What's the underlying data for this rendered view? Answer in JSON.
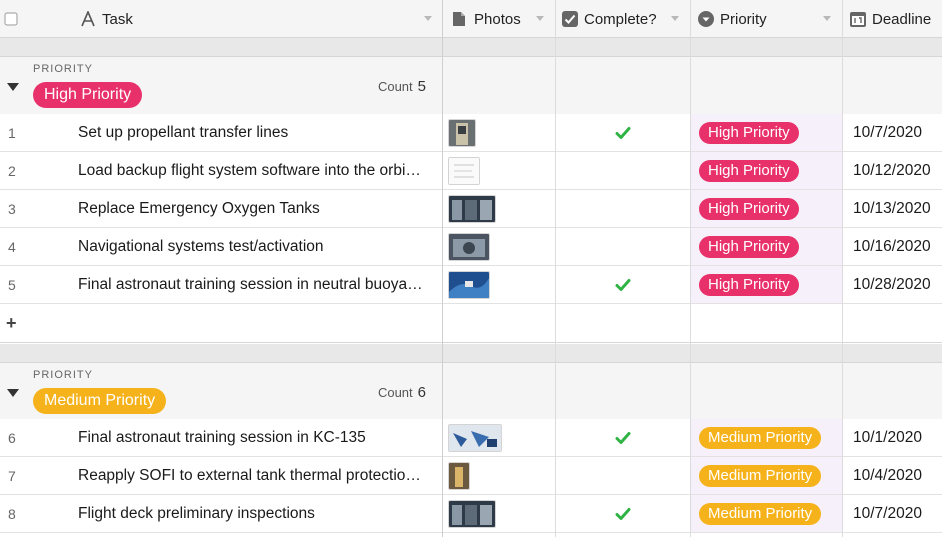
{
  "header": {
    "columns": [
      {
        "label": "Task",
        "icon": "text-type-icon"
      },
      {
        "label": "Photos",
        "icon": "attachment-icon"
      },
      {
        "label": "Complete?",
        "icon": "checkbox-icon"
      },
      {
        "label": "Priority",
        "icon": "single-select-icon"
      },
      {
        "label": "Deadline",
        "icon": "calendar-icon"
      }
    ]
  },
  "colors": {
    "high": "#e8306a",
    "medium": "#f6b21b",
    "check": "#2fb344",
    "priority_bg": "#f6f0fb"
  },
  "groups": [
    {
      "label": "PRIORITY",
      "value": "High Priority",
      "count_label": "Count",
      "count": "5",
      "color": "high",
      "add_label": "+",
      "rows": [
        {
          "num": "1",
          "task": "Set up propellant transfer lines",
          "photo": "tall",
          "complete": true,
          "priority": "High Priority",
          "deadline": "10/7/2020"
        },
        {
          "num": "2",
          "task": "Load backup flight system software into the orbi…",
          "photo": "doc",
          "complete": false,
          "priority": "High Priority",
          "deadline": "10/12/2020"
        },
        {
          "num": "3",
          "task": "Replace Emergency Oxygen Tanks",
          "photo": "wide",
          "complete": false,
          "priority": "High Priority",
          "deadline": "10/13/2020"
        },
        {
          "num": "4",
          "task": "Navigational systems test/activation",
          "photo": "mid",
          "complete": false,
          "priority": "High Priority",
          "deadline": "10/16/2020"
        },
        {
          "num": "5",
          "task": "Final astronaut training session in neutral buoya…",
          "photo": "blue",
          "complete": true,
          "priority": "High Priority",
          "deadline": "10/28/2020"
        }
      ]
    },
    {
      "label": "PRIORITY",
      "value": "Medium Priority",
      "count_label": "Count",
      "count": "6",
      "color": "medium",
      "rows": [
        {
          "num": "6",
          "task": "Final astronaut training session in KC-135",
          "photo": "bluewide",
          "complete": true,
          "priority": "Medium Priority",
          "deadline": "10/1/2020"
        },
        {
          "num": "7",
          "task": "Reapply SOFI to external tank thermal protectio…",
          "photo": "narrow",
          "complete": false,
          "priority": "Medium Priority",
          "deadline": "10/4/2020"
        },
        {
          "num": "8",
          "task": "Flight deck preliminary inspections",
          "photo": "wide",
          "complete": true,
          "priority": "Medium Priority",
          "deadline": "10/7/2020"
        }
      ]
    }
  ]
}
